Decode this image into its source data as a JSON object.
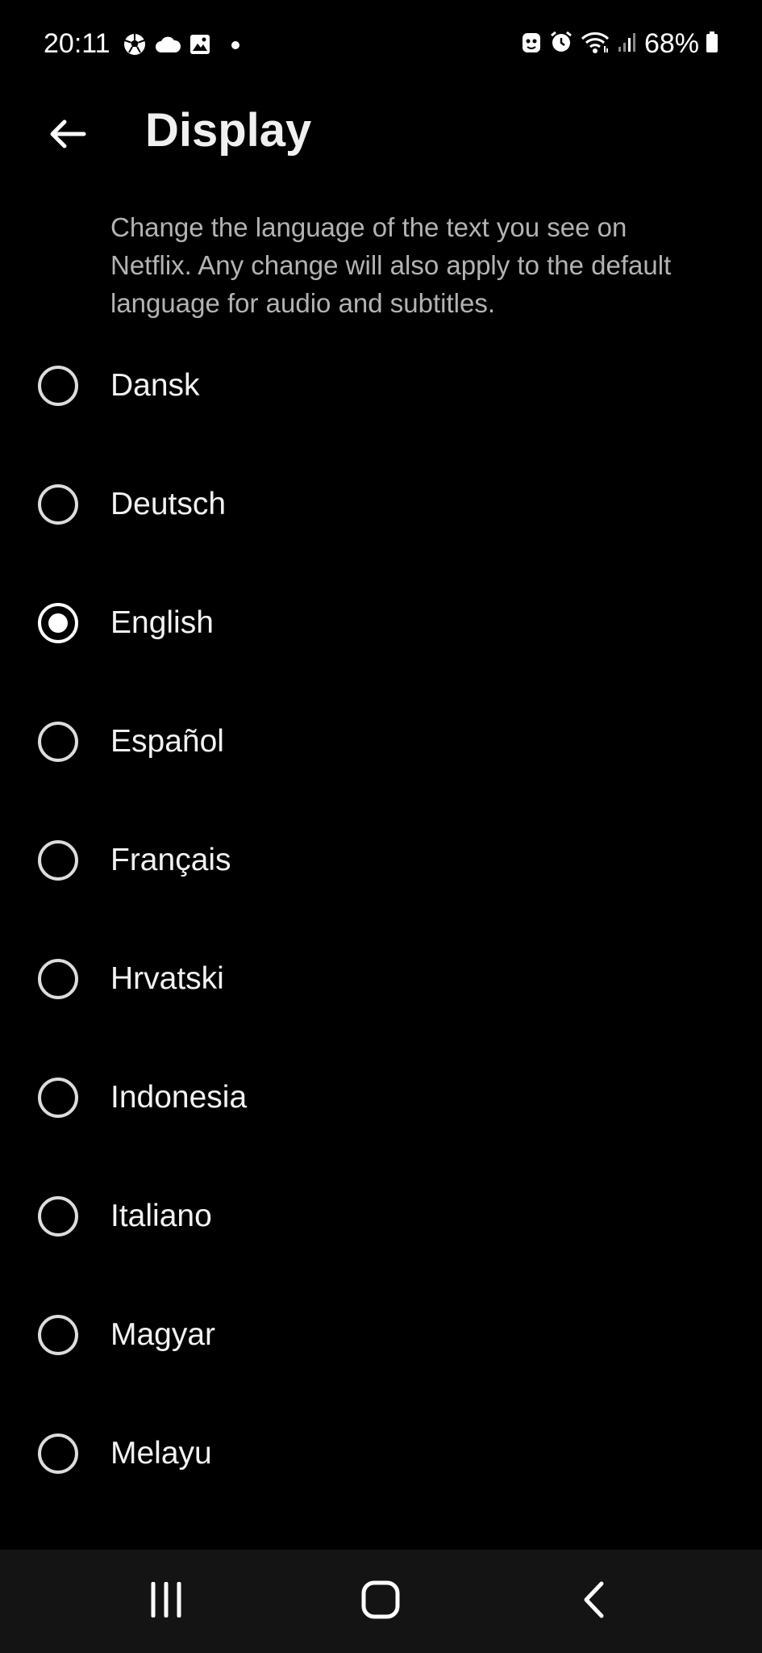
{
  "status_bar": {
    "time": "20:11",
    "battery_percent": "68%",
    "left_icons": [
      "soccer-ball-icon",
      "cloud-icon",
      "gallery-icon",
      "dot-icon"
    ],
    "right_icons": [
      "bixby-routine-icon",
      "alarm-icon",
      "wifi-icon",
      "signal-icon",
      "battery-icon"
    ]
  },
  "header": {
    "title": "Display",
    "back_icon": "arrow-left-icon"
  },
  "description": "Change the language of the text you see on Netflix. Any change will also apply to the default language for audio and subtitles.",
  "languages": [
    {
      "label": "Dansk",
      "selected": false
    },
    {
      "label": "Deutsch",
      "selected": false
    },
    {
      "label": "English",
      "selected": true
    },
    {
      "label": "Español",
      "selected": false
    },
    {
      "label": "Français",
      "selected": false
    },
    {
      "label": "Hrvatski",
      "selected": false
    },
    {
      "label": "Indonesia",
      "selected": false
    },
    {
      "label": "Italiano",
      "selected": false
    },
    {
      "label": "Magyar",
      "selected": false
    },
    {
      "label": "Melayu",
      "selected": false
    }
  ],
  "nav_bar": {
    "buttons": [
      "recent-apps-icon",
      "home-icon",
      "back-icon"
    ]
  },
  "colors": {
    "background": "#000000",
    "nav_background": "#141414",
    "text_primary": "#f2f2f2",
    "text_secondary": "#b3b3b3"
  }
}
